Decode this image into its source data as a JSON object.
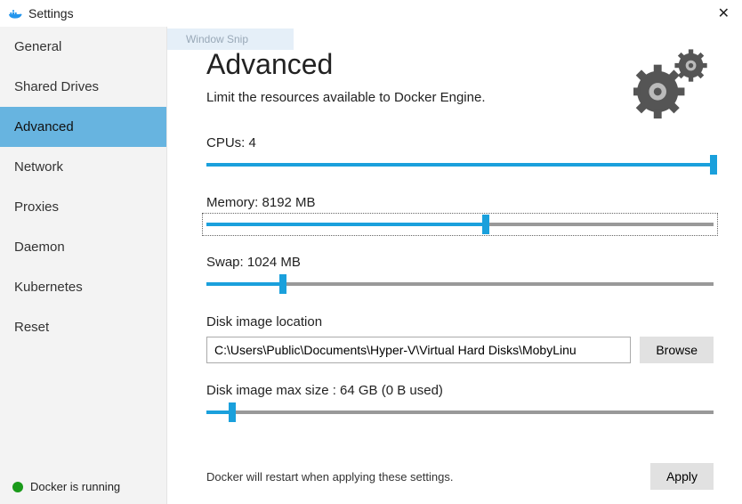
{
  "window": {
    "title": "Settings",
    "close_symbol": "✕"
  },
  "snip_ghost": "Window Snip",
  "sidebar": {
    "items": [
      {
        "label": "General",
        "selected": false
      },
      {
        "label": "Shared Drives",
        "selected": false
      },
      {
        "label": "Advanced",
        "selected": true
      },
      {
        "label": "Network",
        "selected": false
      },
      {
        "label": "Proxies",
        "selected": false
      },
      {
        "label": "Daemon",
        "selected": false
      },
      {
        "label": "Kubernetes",
        "selected": false
      },
      {
        "label": "Reset",
        "selected": false
      }
    ],
    "status_text": "Docker is running",
    "status_color": "#1a9a1a"
  },
  "page": {
    "title": "Advanced",
    "subtitle": "Limit the resources available to Docker Engine."
  },
  "sliders": {
    "cpus": {
      "label": "CPUs: 4",
      "percent": 100
    },
    "memory": {
      "label": "Memory: 8192 MB",
      "percent": 55,
      "focused": true
    },
    "swap": {
      "label": "Swap: 1024 MB",
      "percent": 15
    }
  },
  "disk": {
    "location_label": "Disk image location",
    "location_value": "C:\\Users\\Public\\Documents\\Hyper-V\\Virtual Hard Disks\\MobyLinu",
    "browse_label": "Browse",
    "max_size_label": "Disk image max size : 64 GB (0 B  used)",
    "max_size_percent": 5
  },
  "footer": {
    "note": "Docker will restart when applying these settings.",
    "apply_label": "Apply"
  }
}
